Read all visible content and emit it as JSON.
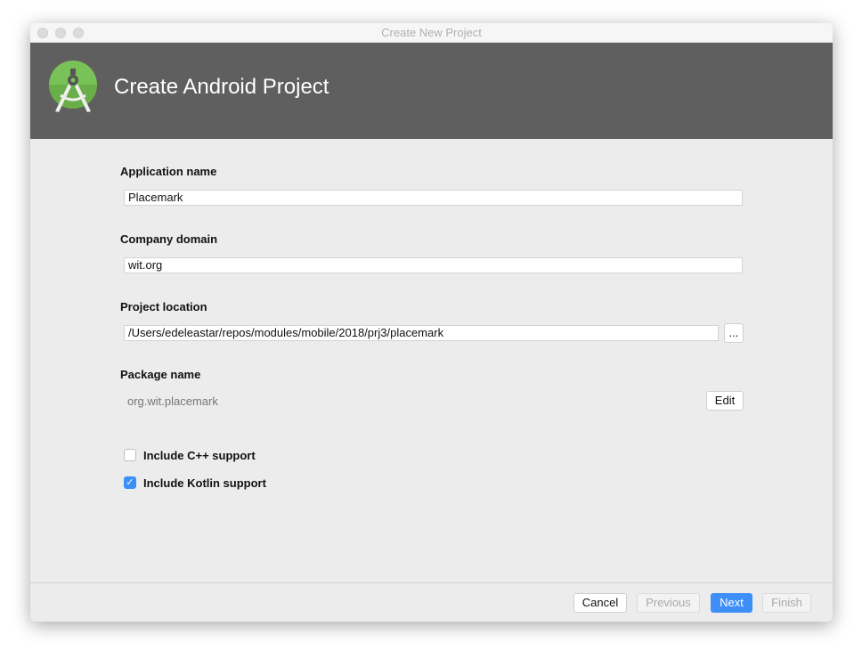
{
  "window": {
    "title": "Create New Project"
  },
  "header": {
    "title": "Create Android Project",
    "logo": "android-studio-logo",
    "accent": "#78c257"
  },
  "form": {
    "app_name_label": "Application name",
    "app_name_value": "Placemark",
    "domain_label": "Company domain",
    "domain_value": "wit.org",
    "location_label": "Project location",
    "location_value": "/Users/edeleastar/repos/modules/mobile/2018/prj3/placemark",
    "browse_label": "...",
    "package_label": "Package name",
    "package_value": "org.wit.placemark",
    "edit_label": "Edit",
    "cpp_label": "Include C++ support",
    "cpp_checked": false,
    "kotlin_label": "Include Kotlin support",
    "kotlin_checked": true,
    "check_mark": "✓"
  },
  "footer": {
    "cancel": "Cancel",
    "previous": "Previous",
    "next": "Next",
    "finish": "Finish"
  }
}
